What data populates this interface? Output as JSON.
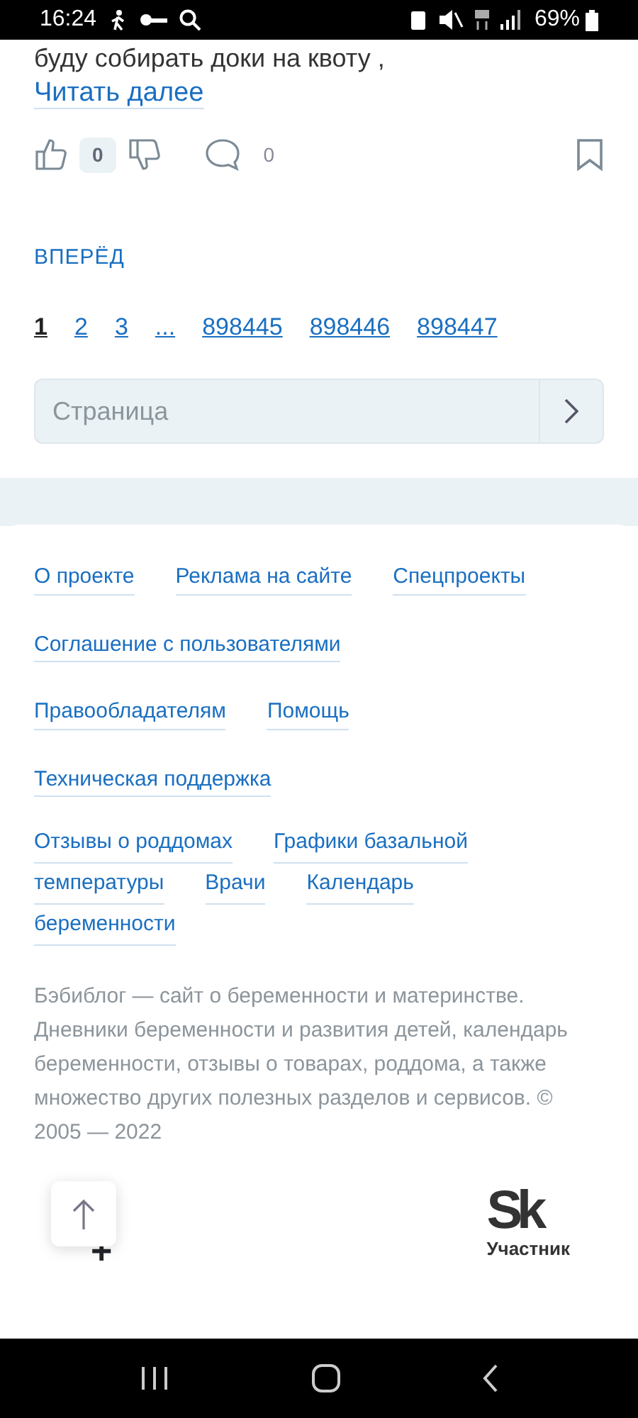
{
  "status_bar": {
    "time": "16:24",
    "battery": "69%"
  },
  "post": {
    "text_cut": "буду собирать доки на квоту ,",
    "read_more": "Читать далее",
    "likes": "0",
    "comments": "0"
  },
  "pager": {
    "next": "ВПЕРЁД",
    "pages": [
      {
        "label": "1",
        "selected": true
      },
      {
        "label": "2",
        "selected": false
      },
      {
        "label": "3",
        "selected": false
      },
      {
        "label": "...",
        "selected": false
      },
      {
        "label": "898445",
        "selected": false
      },
      {
        "label": "898446",
        "selected": false
      },
      {
        "label": "898447",
        "selected": false
      }
    ],
    "page_input": {
      "placeholder": "Страница"
    }
  },
  "footer": {
    "link_rows": [
      [
        "О проекте",
        "Реклама на сайте",
        "Спецпроекты"
      ],
      [
        "Соглашение с пользователями"
      ],
      [
        "Правообладателям",
        "Помощь"
      ],
      [
        "Техническая поддержка"
      ]
    ],
    "topic_link_lines": [
      [
        "Отзывы о роддомах",
        "Графики базальной"
      ],
      [
        "температуры",
        "Врачи",
        "Календарь"
      ],
      [
        "беременности"
      ]
    ],
    "about": "Бэбиблог — сайт о беременности и материнстве. Дневники беременности и развития детей, календарь беременности, отзывы о товарах, роддома, а также множество других полезных разделов и сервисов. © 2005 — 2022",
    "age_mark": "+",
    "logo": "Sk",
    "logo_caption": "Участник"
  }
}
